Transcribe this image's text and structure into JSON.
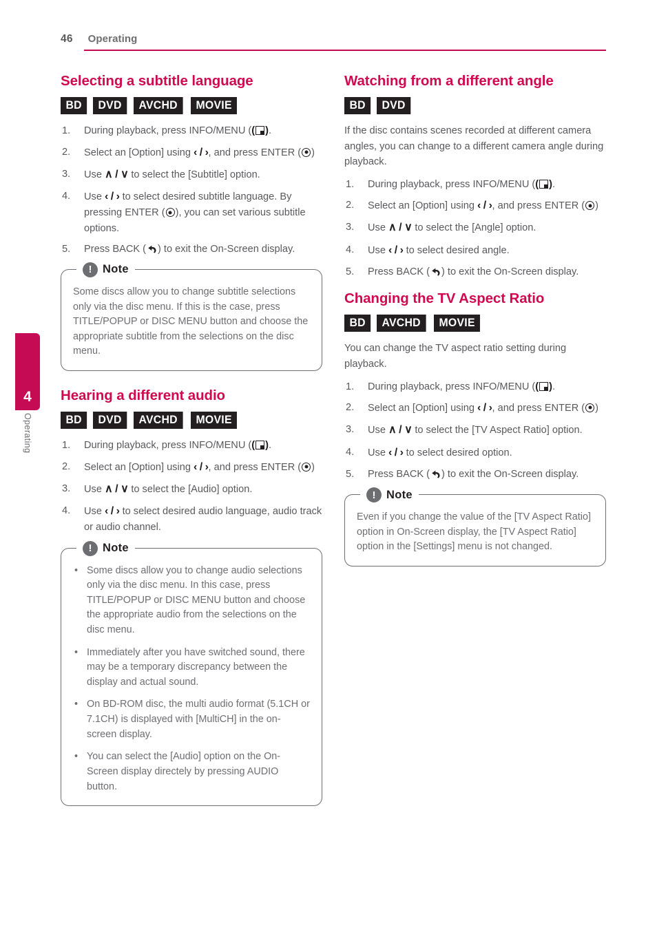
{
  "header": {
    "page_number": "46",
    "section": "Operating",
    "rule_color": "#c2084f"
  },
  "chapter_tab": {
    "number": "4",
    "label": "Operating",
    "color": "#c40b53"
  },
  "theme": {
    "heading_color": "#cf0a50",
    "body_color": "#58595b",
    "note_color": "#6d6e71",
    "badge_bg": "#231f20"
  },
  "left_column": {
    "sections": [
      {
        "title": "Selecting a subtitle language",
        "badges": [
          "BD",
          "DVD",
          "AVCHD",
          "MOVIE"
        ],
        "steps": [
          {
            "num": "1.",
            "parts": [
              "During playback, press INFO/MENU (",
              "menu-icon",
              ")."
            ]
          },
          {
            "num": "2.",
            "parts": [
              "Select an [Option] using ",
              "left-right-icon",
              ", and press ENTER (",
              "enter-icon",
              ")"
            ]
          },
          {
            "num": "3.",
            "parts": [
              "Use ",
              "up-down-icon",
              " to select the [Subtitle] option."
            ]
          },
          {
            "num": "4.",
            "parts": [
              "Use ",
              "left-right-icon",
              " to select desired subtitle language. By pressing ENTER (",
              "enter-icon",
              "), you can set various subtitle options."
            ]
          },
          {
            "num": "5.",
            "parts": [
              "Press BACK (",
              "back-icon",
              ") to exit the On-Screen display."
            ]
          }
        ],
        "note": {
          "title": "Note",
          "icon": "exclamation-icon",
          "paragraphs": [
            "Some discs allow you to change subtitle selections only via the disc menu. If this is the case, press TITLE/POPUP or DISC MENU button and choose the appropriate subtitle from the selections on the disc menu."
          ]
        }
      },
      {
        "title": "Hearing a different audio",
        "badges": [
          "BD",
          "DVD",
          "AVCHD",
          "MOVIE"
        ],
        "steps": [
          {
            "num": "1.",
            "parts": [
              "During playback, press INFO/MENU (",
              "menu-icon",
              ")."
            ]
          },
          {
            "num": "2.",
            "parts": [
              "Select an [Option] using ",
              "left-right-icon",
              ", and press ENTER (",
              "enter-icon",
              ")"
            ]
          },
          {
            "num": "3.",
            "parts": [
              "Use ",
              "up-down-icon",
              " to select the [Audio] option."
            ]
          },
          {
            "num": "4.",
            "parts": [
              "Use ",
              "left-right-icon",
              " to select desired audio language, audio track or audio channel."
            ]
          }
        ],
        "note": {
          "title": "Note",
          "icon": "exclamation-icon",
          "bullets": [
            "Some discs allow you to change audio selections only via the disc menu. In this case, press TITLE/POPUP or DISC MENU button and choose the appropriate audio from the selections on the disc menu.",
            "Immediately after you have switched sound, there may be a temporary discrepancy between the display and actual sound.",
            "On BD-ROM disc, the multi audio format (5.1CH or 7.1CH) is displayed with [MultiCH] in the on-screen display.",
            "You can select the [Audio] option on the On-Screen display directely by pressing AUDIO button."
          ]
        }
      }
    ]
  },
  "right_column": {
    "sections": [
      {
        "title": "Watching from a different angle",
        "badges": [
          "BD",
          "DVD"
        ],
        "intro": "If the disc contains scenes recorded at different camera angles, you can change to a different camera angle during playback.",
        "steps": [
          {
            "num": "1.",
            "parts": [
              "During playback, press INFO/MENU (",
              "menu-icon",
              ")."
            ]
          },
          {
            "num": "2.",
            "parts": [
              "Select an [Option] using ",
              "left-right-icon",
              ", and press ENTER (",
              "enter-icon",
              ")"
            ]
          },
          {
            "num": "3.",
            "parts": [
              "Use ",
              "up-down-icon",
              " to select the [Angle] option."
            ]
          },
          {
            "num": "4.",
            "parts": [
              "Use ",
              "left-right-icon",
              " to select desired angle."
            ]
          },
          {
            "num": "5.",
            "parts": [
              "Press BACK (",
              "back-icon",
              ") to exit the On-Screen display."
            ]
          }
        ]
      },
      {
        "title": "Changing the TV Aspect Ratio",
        "badges": [
          "BD",
          "AVCHD",
          "MOVIE"
        ],
        "intro": "You can change the TV aspect ratio setting during playback.",
        "steps": [
          {
            "num": "1.",
            "parts": [
              "During playback, press INFO/MENU (",
              "menu-icon",
              ")."
            ]
          },
          {
            "num": "2.",
            "parts": [
              "Select an [Option] using ",
              "left-right-icon",
              ", and press ENTER (",
              "enter-icon",
              ")"
            ]
          },
          {
            "num": "3.",
            "parts": [
              "Use ",
              "up-down-icon",
              " to select the [TV Aspect Ratio] option."
            ]
          },
          {
            "num": "4.",
            "parts": [
              "Use ",
              "left-right-icon",
              " to select desired option."
            ]
          },
          {
            "num": "5.",
            "parts": [
              "Press BACK (",
              "back-icon",
              ") to exit the On-Screen display."
            ]
          }
        ],
        "note": {
          "title": "Note",
          "icon": "exclamation-icon",
          "paragraphs": [
            "Even if you change the value of the [TV Aspect Ratio] option in On-Screen display, the [TV Aspect Ratio] option in the [Settings] menu is not changed."
          ]
        }
      }
    ]
  },
  "glyphs": {
    "left_right": "‹ / ›",
    "up_down": "∧ / ∨",
    "note_mark": "!",
    "bullet": "•"
  }
}
